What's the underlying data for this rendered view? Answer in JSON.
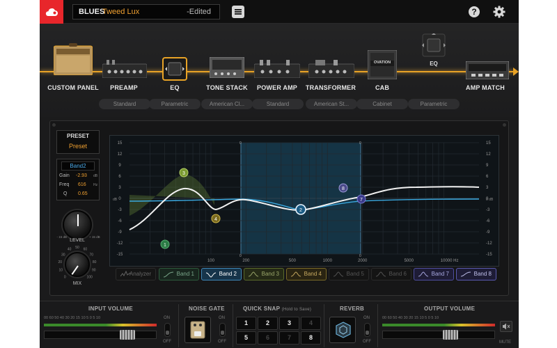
{
  "topbar": {
    "preset_category": "BLUES",
    "preset_name": "Tweed Lux",
    "edited_label": "-Edited",
    "help_label": "?"
  },
  "chain": {
    "blocks": [
      {
        "label": "CUSTOM PANEL",
        "value": ""
      },
      {
        "label": "PREAMP",
        "value": "Standard"
      },
      {
        "label": "EQ",
        "value": "Parametric"
      },
      {
        "label": "TONE STACK",
        "value": "American Cl..."
      },
      {
        "label": "POWER AMP",
        "value": "Standard"
      },
      {
        "label": "TRANSFORMER",
        "value": "American St..."
      },
      {
        "label": "CAB",
        "value": "Cabinet"
      },
      {
        "label": "EQ",
        "value": "Parametric"
      },
      {
        "label": "AMP MATCH",
        "value": ""
      }
    ],
    "cab_brand": "OVATION"
  },
  "eq": {
    "preset_label": "PRESET",
    "preset_value": "Preset",
    "band_name": "Band2",
    "gain_label": "Gain",
    "gain_value": "-2.93",
    "gain_unit": "dB",
    "freq_label": "Freq",
    "freq_value": "616",
    "freq_unit": "Hz",
    "q_label": "Q",
    "q_value": "0.65",
    "level_label": "LEVEL",
    "level_min": "- 15 dB",
    "level_max": "+ 15 dB",
    "mix_label": "MIX",
    "mix_ticks": [
      "0",
      "10",
      "20",
      "30",
      "40",
      "50",
      "60",
      "70",
      "80",
      "90",
      "100"
    ],
    "y_ticks": [
      "15",
      "12",
      "9",
      "6",
      "3",
      "0",
      "-3",
      "-6",
      "-9",
      "-12",
      "-15"
    ],
    "db_label": "dB",
    "zero_db_label": "0 dB",
    "x_ticks": [
      "100",
      "200",
      "500",
      "1000",
      "2000",
      "5000",
      "10000 Hz"
    ],
    "node_labels": [
      "1",
      "2",
      "3",
      "4",
      "7",
      "8"
    ],
    "range_markers": [
      "0",
      "0",
      "0",
      "0"
    ],
    "tabs": [
      "Analyzer",
      "Band 1",
      "Band 2",
      "Band 3",
      "Band 4",
      "Band 5",
      "Band 6",
      "Band 7",
      "Band 8"
    ]
  },
  "bottom": {
    "input_volume": "INPUT VOLUME",
    "noise_gate": "NOISE GATE",
    "quick_snap": "QUICK SNAP",
    "quick_snap_hint": "(Hold to Save)",
    "reverb": "REVERB",
    "output_volume": "OUTPUT VOLUME",
    "meter_ticks": "00  60  50  40     30      20     15    10    5    0    5   10",
    "on_label": "ON",
    "off_label": "OFF",
    "mute_label": "MUTE",
    "snaps": [
      "1",
      "2",
      "3",
      "4",
      "5",
      "6",
      "7",
      "8"
    ]
  },
  "colors": {
    "accent": "#e8a326",
    "brand_red": "#e8262b",
    "curve_blue": "#3aa9e0",
    "selected_band": "#4aa9d8"
  }
}
